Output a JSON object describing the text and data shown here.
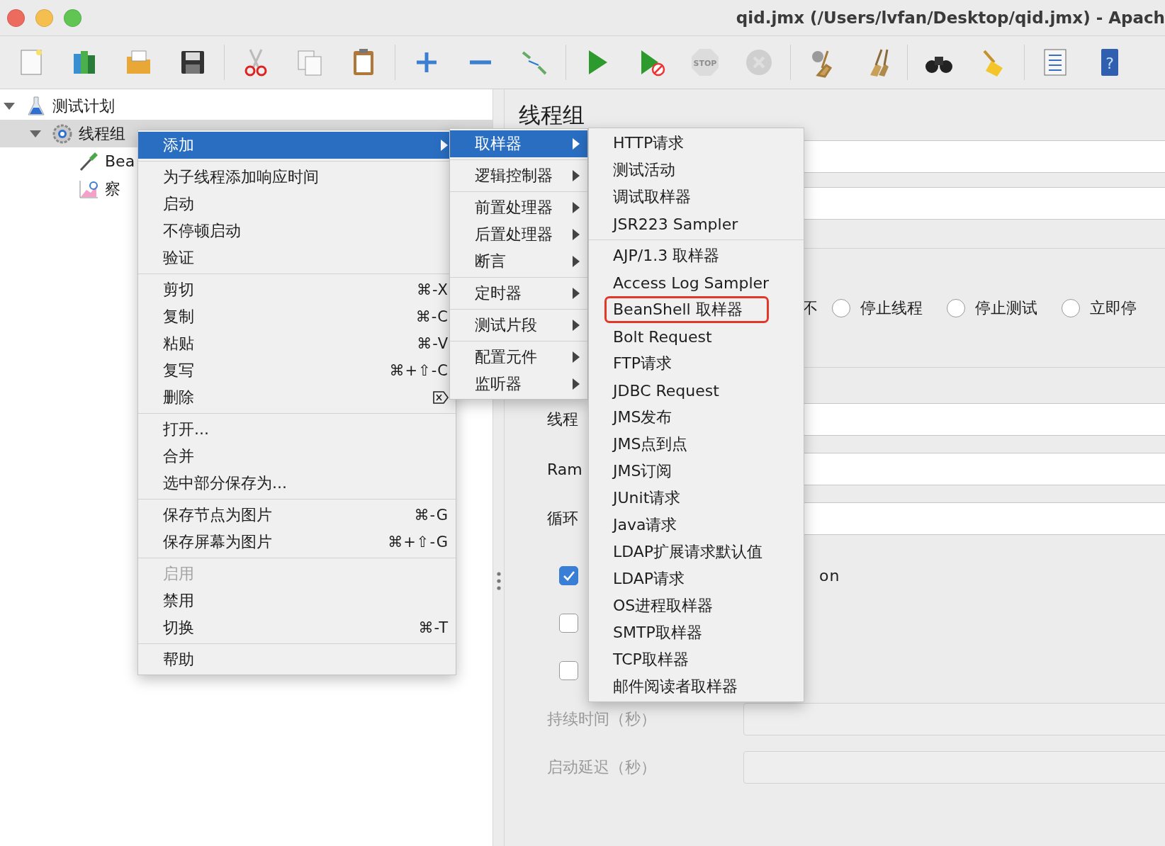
{
  "window": {
    "title": "qid.jmx (/Users/lvfan/Desktop/qid.jmx) - Apach"
  },
  "toolbar": [
    {
      "buttons": [
        {
          "kind": "new",
          "disabled": false
        },
        {
          "kind": "templates",
          "disabled": false
        },
        {
          "kind": "open",
          "disabled": false
        },
        {
          "kind": "save",
          "disabled": false
        }
      ]
    },
    {
      "buttons": [
        {
          "kind": "cut",
          "disabled": false
        },
        {
          "kind": "copy",
          "disabled": false
        },
        {
          "kind": "paste",
          "disabled": false
        }
      ]
    },
    {
      "buttons": [
        {
          "kind": "add",
          "disabled": false
        },
        {
          "kind": "remove",
          "disabled": false
        },
        {
          "kind": "toggle",
          "disabled": false
        }
      ]
    },
    {
      "buttons": [
        {
          "kind": "start",
          "disabled": false
        },
        {
          "kind": "start-no-pause",
          "disabled": false
        },
        {
          "kind": "stop",
          "disabled": true,
          "label": "STOP"
        },
        {
          "kind": "shutdown",
          "disabled": true
        }
      ]
    },
    {
      "buttons": [
        {
          "kind": "clear",
          "disabled": false
        },
        {
          "kind": "clear-all",
          "disabled": false
        }
      ]
    },
    {
      "buttons": [
        {
          "kind": "search",
          "disabled": false
        },
        {
          "kind": "reset-search",
          "disabled": false
        }
      ]
    },
    {
      "buttons": [
        {
          "kind": "function-helper",
          "disabled": false
        },
        {
          "kind": "help",
          "disabled": false,
          "label": "?"
        }
      ]
    }
  ],
  "tree": [
    {
      "label": "测试计划",
      "kind": "test-plan",
      "expanded": true,
      "selected": false,
      "children": [
        {
          "label": "线程组",
          "kind": "thread-group",
          "expanded": true,
          "selected": true,
          "children": [
            {
              "label": "Bea",
              "kind": "sampler",
              "selected": false
            },
            {
              "label": "察",
              "kind": "listener",
              "selected": false
            }
          ]
        }
      ]
    }
  ],
  "editor": {
    "title": "线程组",
    "header_fields": [
      {
        "disabled": false
      },
      {
        "disabled": false
      }
    ],
    "error_action": {
      "label_tail": "不",
      "options": [
        {
          "label": "停止线程",
          "selected": false
        },
        {
          "label": "停止测试",
          "selected": false
        },
        {
          "label": "立即停",
          "selected": false
        }
      ]
    },
    "thread_fields": [
      {
        "label": "线程",
        "disabled": false
      },
      {
        "label": "Ram",
        "disabled": false
      },
      {
        "label": "循环",
        "disabled": false
      }
    ],
    "checkboxes": [
      {
        "checked": true,
        "label_tail": "on"
      },
      {
        "checked": false
      },
      {
        "checked": false
      }
    ],
    "schedule_fields": [
      {
        "label": "持续时间（秒）",
        "disabled": true
      },
      {
        "label": "启动延迟（秒）",
        "disabled": true
      }
    ]
  },
  "context_menu": {
    "groups": [
      {
        "items": [
          {
            "label": "添加",
            "submenu": true,
            "selected": true
          }
        ]
      },
      {
        "items": [
          {
            "label": "为子线程添加响应时间",
            "selected": false
          },
          {
            "label": "启动",
            "selected": false
          },
          {
            "label": "不停顿启动",
            "selected": false
          },
          {
            "label": "验证",
            "selected": false
          }
        ]
      },
      {
        "items": [
          {
            "label": "剪切",
            "shortcut": "⌘-X",
            "selected": false
          },
          {
            "label": "复制",
            "shortcut": "⌘-C",
            "selected": false
          },
          {
            "label": "粘贴",
            "shortcut": "⌘-V",
            "selected": false
          },
          {
            "label": "复写",
            "shortcut": "⌘+⇧-C",
            "selected": false
          },
          {
            "label": "删除",
            "shortcut_icon": true,
            "selected": false
          }
        ]
      },
      {
        "items": [
          {
            "label": "打开...",
            "selected": false
          },
          {
            "label": "合并",
            "selected": false
          },
          {
            "label": "选中部分保存为...",
            "selected": false
          }
        ]
      },
      {
        "items": [
          {
            "label": "保存节点为图片",
            "shortcut": "⌘-G",
            "selected": false
          },
          {
            "label": "保存屏幕为图片",
            "shortcut": "⌘+⇧-G",
            "selected": false
          }
        ]
      },
      {
        "items": [
          {
            "label": "启用",
            "disabled": true,
            "selected": false
          },
          {
            "label": "禁用",
            "selected": false
          },
          {
            "label": "切换",
            "shortcut": "⌘-T",
            "selected": false
          }
        ]
      },
      {
        "items": [
          {
            "label": "帮助",
            "selected": false
          }
        ]
      }
    ]
  },
  "add_submenu": {
    "groups": [
      {
        "items": [
          {
            "label": "取样器",
            "selected": true
          }
        ]
      },
      {
        "items": [
          {
            "label": "逻辑控制器",
            "selected": false
          }
        ]
      },
      {
        "items": [
          {
            "label": "前置处理器",
            "selected": false
          },
          {
            "label": "后置处理器",
            "selected": false
          },
          {
            "label": "断言",
            "selected": false
          }
        ]
      },
      {
        "items": [
          {
            "label": "定时器",
            "selected": false
          }
        ]
      },
      {
        "items": [
          {
            "label": "测试片段",
            "selected": false
          }
        ]
      },
      {
        "items": [
          {
            "label": "配置元件",
            "selected": false
          },
          {
            "label": "监听器",
            "selected": false
          }
        ]
      }
    ]
  },
  "sampler_submenu": {
    "groups": [
      {
        "items": [
          {
            "label": "HTTP请求",
            "annotated": false
          },
          {
            "label": "测试活动",
            "annotated": false
          },
          {
            "label": "调试取样器",
            "annotated": false
          },
          {
            "label": "JSR223 Sampler",
            "annotated": false
          }
        ]
      },
      {
        "items": [
          {
            "label": "AJP/1.3 取样器",
            "annotated": false
          },
          {
            "label": "Access Log Sampler",
            "annotated": false
          },
          {
            "label": "BeanShell 取样器",
            "annotated": true
          },
          {
            "label": "Bolt Request",
            "annotated": false
          },
          {
            "label": "FTP请求",
            "annotated": false
          },
          {
            "label": "JDBC Request",
            "annotated": false
          },
          {
            "label": "JMS发布",
            "annotated": false
          },
          {
            "label": "JMS点到点",
            "annotated": false
          },
          {
            "label": "JMS订阅",
            "annotated": false
          },
          {
            "label": "JUnit请求",
            "annotated": false
          },
          {
            "label": "Java请求",
            "annotated": false
          },
          {
            "label": "LDAP扩展请求默认值",
            "annotated": false
          },
          {
            "label": "LDAP请求",
            "annotated": false
          },
          {
            "label": "OS进程取样器",
            "annotated": false
          },
          {
            "label": "SMTP取样器",
            "annotated": false
          },
          {
            "label": "TCP取样器",
            "annotated": false
          },
          {
            "label": "邮件阅读者取样器",
            "annotated": false
          }
        ]
      }
    ]
  }
}
